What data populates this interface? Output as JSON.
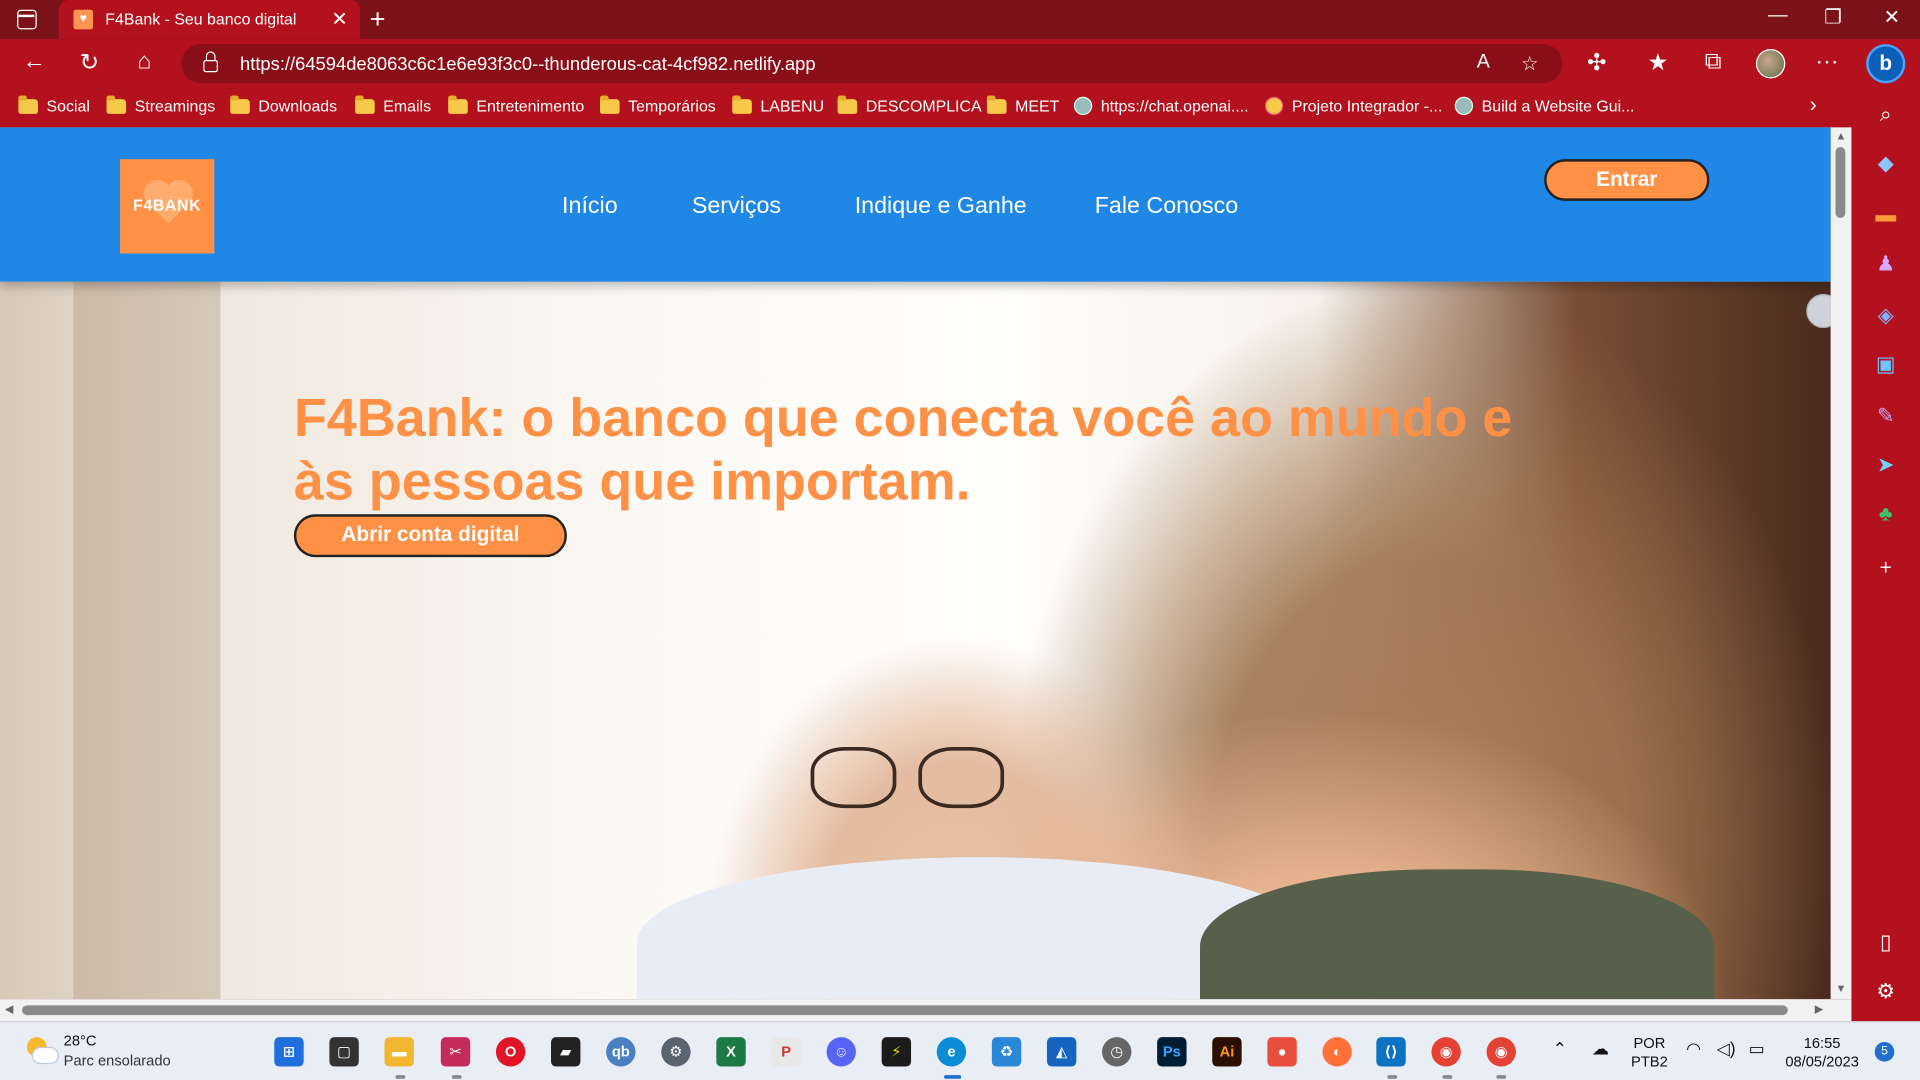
{
  "browser": {
    "tab_title": "F4Bank - Seu banco digital",
    "url": "https://64594de8063c6c1e6e93f3c0--thunderous-cat-4cf982.netlify.app",
    "bookmarks": [
      {
        "label": "Social",
        "icon": "folder-icon"
      },
      {
        "label": "Streamings",
        "icon": "folder-icon"
      },
      {
        "label": "Downloads",
        "icon": "folder-icon"
      },
      {
        "label": "Emails",
        "icon": "folder-icon"
      },
      {
        "label": "Entretenimento",
        "icon": "folder-icon"
      },
      {
        "label": "Temporários",
        "icon": "folder-icon"
      },
      {
        "label": "LABENU",
        "icon": "folder-icon"
      },
      {
        "label": "DESCOMPLICA",
        "icon": "folder-icon"
      },
      {
        "label": "MEET",
        "icon": "folder-icon"
      },
      {
        "label": "https://chat.openai....",
        "icon": "openai-icon"
      },
      {
        "label": "Projeto Integrador -...",
        "icon": "site-icon"
      },
      {
        "label": "Build a Website Gui...",
        "icon": "openai-icon"
      }
    ]
  },
  "site": {
    "logo_text": "F4BANK",
    "nav": [
      "Início",
      "Serviços",
      "Indique e Ganhe",
      "Fale Conosco"
    ],
    "login_button": "Entrar",
    "hero_title": "F4Bank: o banco que conecta você ao mundo e às pessoas que importam.",
    "cta_button": "Abrir conta digital",
    "colors": {
      "header": "#1f87e5",
      "accent": "#ff9147"
    }
  },
  "taskbar": {
    "temperature": "28°C",
    "weather": "Parc ensolarado",
    "language": "POR",
    "layout": "PTB2",
    "time": "16:55",
    "date": "08/05/2023",
    "notifications": "5"
  }
}
